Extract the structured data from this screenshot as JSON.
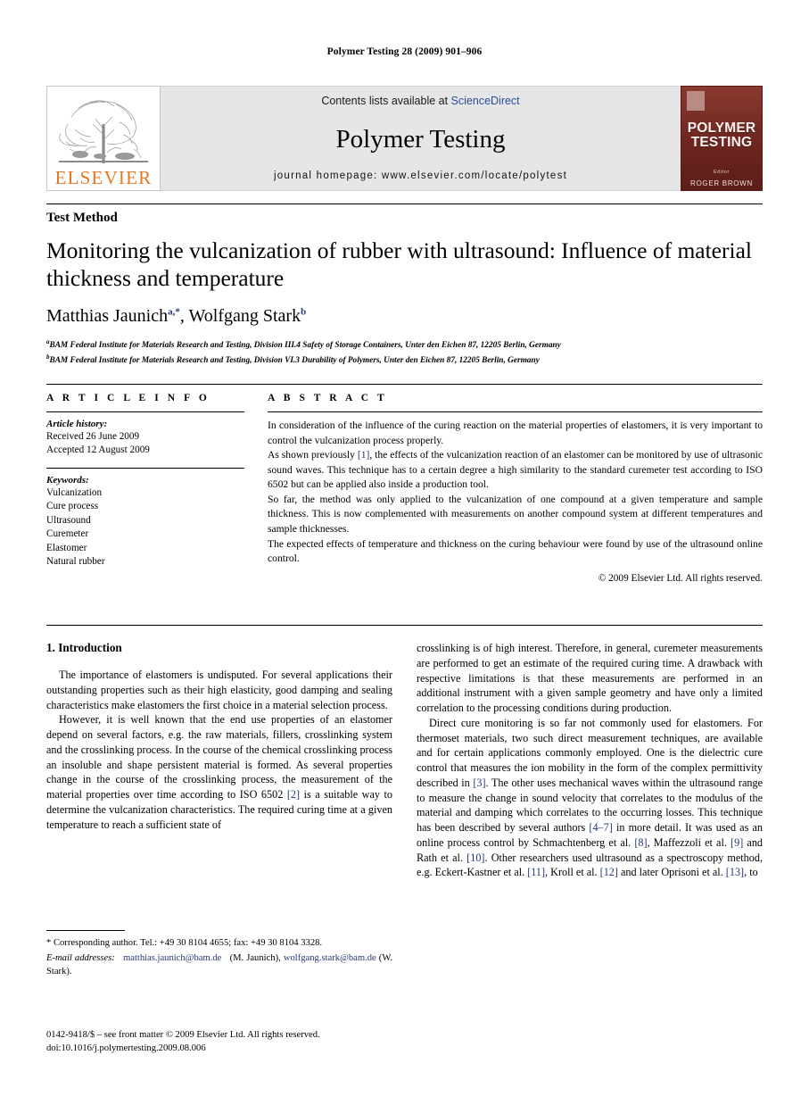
{
  "running_head": "Polymer Testing 28 (2009) 901–906",
  "masthead": {
    "elsevier_wordmark": "ELSEVIER",
    "contents_prefix": "Contents lists available at ",
    "contents_link": "ScienceDirect",
    "journal_name": "Polymer Testing",
    "homepage": "journal homepage: www.elsevier.com/locate/polytest",
    "cover": {
      "title_line1": "POLYMER",
      "title_line2": "TESTING",
      "editor_label": "Editor",
      "editor_name": "ROGER BROWN"
    }
  },
  "title_block": {
    "section_kind": "Test Method",
    "title": "Monitoring the vulcanization of rubber with ultrasound: Influence of material thickness and temperature",
    "author1_name": "Matthias Jaunich",
    "author1_sup": "a,*",
    "author_separator": ", ",
    "author2_name": "Wolfgang Stark",
    "author2_sup": "b",
    "affiliation_a_sup": "a",
    "affiliation_a": "BAM Federal Institute for Materials Research and Testing, Division III.4 Safety of Storage Containers, Unter den Eichen 87, 12205 Berlin, Germany",
    "affiliation_b_sup": "b",
    "affiliation_b": "BAM Federal Institute for Materials Research and Testing, Division VI.3 Durability of Polymers, Unter den Eichen 87, 12205 Berlin, Germany"
  },
  "article_info": {
    "heading": "A R T I C L E   I N F O",
    "history_label": "Article history:",
    "received": "Received 26 June 2009",
    "accepted": "Accepted 12 August 2009",
    "keywords_label": "Keywords:",
    "keywords": [
      "Vulcanization",
      "Cure process",
      "Ultrasound",
      "Curemeter",
      "Elastomer",
      "Natural rubber"
    ]
  },
  "abstract": {
    "heading": "A B S T R A C T",
    "p1": "In consideration of the influence of the curing reaction on the material properties of elastomers, it is very important to control the vulcanization process properly.",
    "p2_a": "As shown previously ",
    "p2_ref": "[1]",
    "p2_b": ", the effects of the vulcanization reaction of an elastomer can be monitored by use of ultrasonic sound waves. This technique has to a certain degree a high similarity to the standard curemeter test according to ISO 6502 but can be applied also inside a production tool.",
    "p3": "So far, the method was only applied to the vulcanization of one compound at a given temperature and sample thickness. This is now complemented with measurements on another compound system at different temperatures and sample thicknesses.",
    "p4": "The expected effects of temperature and thickness on the curing behaviour were found by use of the ultrasound online control.",
    "copyright": "© 2009 Elsevier Ltd. All rights reserved."
  },
  "body": {
    "intro_heading": "1. Introduction",
    "left_p1": "The importance of elastomers is undisputed. For several applications their outstanding properties such as their high elasticity, good damping and sealing characteristics make elastomers the first choice in a material selection process.",
    "left_p2_a": "However, it is well known that the end use properties of an elastomer depend on several factors, e.g. the raw materials, fillers, crosslinking system and the crosslinking process. In the course of the chemical crosslinking process an insoluble and shape persistent material is formed. As several properties change in the course of the crosslinking process, the measurement of the material properties over time according to ISO 6502 ",
    "left_p2_ref": "[2]",
    "left_p2_b": " is a suitable way to determine the vulcanization characteristics. The required curing time at a given temperature to reach a sufficient state of",
    "right_p1": "crosslinking is of high interest. Therefore, in general, curemeter measurements are performed to get an estimate of the required curing time. A drawback with respective limitations is that these measurements are performed in an additional instrument with a given sample geometry and have only a limited correlation to the processing conditions during production.",
    "right_p2_a": "Direct cure monitoring is so far not commonly used for elastomers. For thermoset materials, two such direct measurement techniques, are available and for certain applications commonly employed. One is the dielectric cure control that measures the ion mobility in the form of the complex permittivity described in ",
    "right_p2_ref1": "[3]",
    "right_p2_b": ". The other uses mechanical waves within the ultrasound range to measure the change in sound velocity that correlates to the modulus of the material and damping which correlates to the occurring losses. This technique has been described by several authors ",
    "right_p2_ref2": "[4–7]",
    "right_p2_c": " in more detail. It was used as an online process control by Schmachtenberg et al. ",
    "right_p2_ref3": "[8]",
    "right_p2_d": ", Maffezzoli et al. ",
    "right_p2_ref4": "[9]",
    "right_p2_e": " and Rath et al. ",
    "right_p2_ref5": "[10]",
    "right_p2_f": ". Other researchers used ultrasound as a spectroscopy method, e.g. Eckert-Kastner et al. ",
    "right_p2_ref6": "[11]",
    "right_p2_g": ", Kroll et al. ",
    "right_p2_ref7": "[12]",
    "right_p2_h": " and later Oprisoni et al. ",
    "right_p2_ref8": "[13]",
    "right_p2_i": ", to"
  },
  "footnotes": {
    "corresponding": "* Corresponding author. Tel.: +49 30 8104 4655; fax: +49 30 8104 3328.",
    "email_label": "E-mail addresses:",
    "email1": "matthias.jaunich@bam.de",
    "email1_owner": "(M. Jaunich),",
    "email2": "wolfgang.stark@bam.de",
    "email2_owner": "(W. Stark)."
  },
  "imprint": {
    "line1": "0142-9418/$ – see front matter © 2009 Elsevier Ltd. All rights reserved.",
    "line2": "doi:10.1016/j.polymertesting.2009.08.006"
  }
}
